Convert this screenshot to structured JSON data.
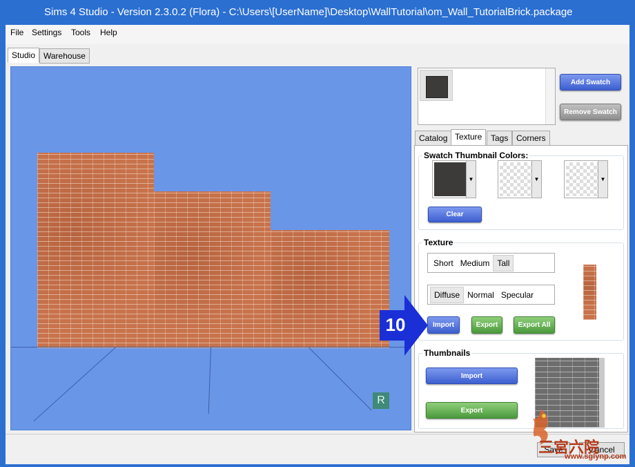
{
  "window": {
    "title": "Sims 4 Studio - Version 2.3.0.2  (Flora)   - C:\\Users\\[UserName]\\Desktop\\WallTutorial\\om_Wall_TutorialBrick.package"
  },
  "menu": [
    "File",
    "Settings",
    "Tools",
    "Help"
  ],
  "main_tabs": [
    "Studio",
    "Warehouse"
  ],
  "viewport": {
    "badge": "R"
  },
  "swatch": {
    "color": "#3c3b39",
    "add_label": "Add Swatch",
    "remove_label": "Remove Swatch"
  },
  "detail_tabs": [
    "Catalog",
    "Texture",
    "Tags",
    "Corners"
  ],
  "detail_tab_selected": "Texture",
  "thumbnail_colors": {
    "label": "Swatch Thumbnail Colors:",
    "colors": [
      "#3c3b39",
      "transparent",
      "transparent"
    ],
    "clear_label": "Clear"
  },
  "texture": {
    "label": "Texture",
    "sizes": [
      "Short",
      "Medium",
      "Tall"
    ],
    "size_selected": "Tall",
    "maps": [
      "Diffuse",
      "Normal",
      "Specular"
    ],
    "map_selected": "Diffuse",
    "import_label": "Import",
    "export_label": "Export",
    "export_all_label": "Export All"
  },
  "callout": {
    "number": "10",
    "color": "#1a2fd6"
  },
  "thumbnails": {
    "label": "Thumbnails",
    "import_label": "Import",
    "export_label": "Export"
  },
  "footer": {
    "save_label": "Save",
    "cancel_label": "Cancel"
  },
  "watermark": {
    "text": "三宫六院",
    "url": "www.sglynp.com"
  }
}
